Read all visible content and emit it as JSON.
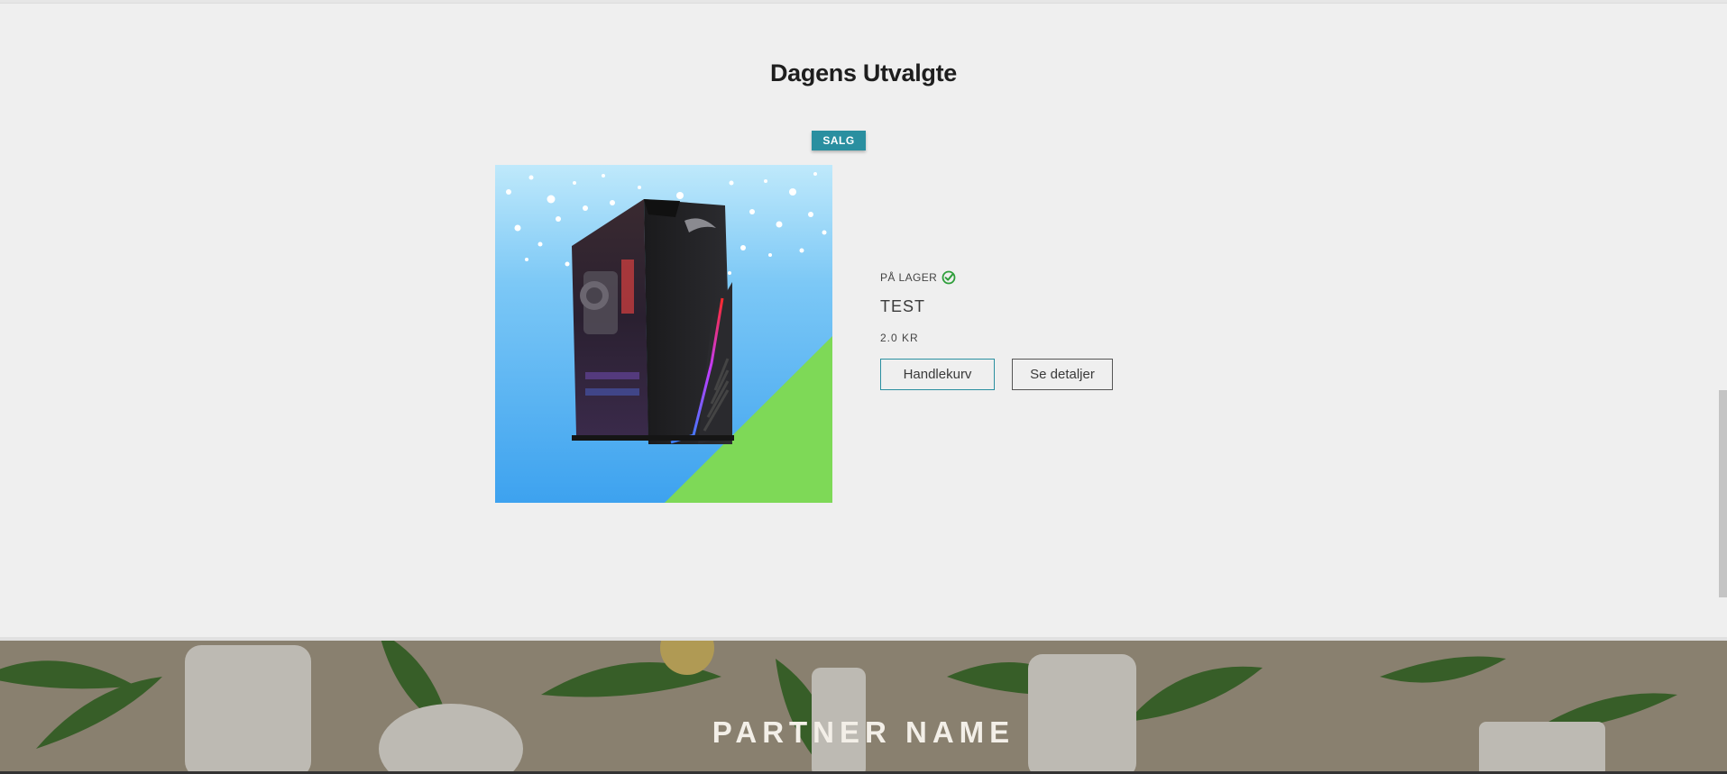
{
  "section": {
    "title": "Dagens Utvalgte"
  },
  "product": {
    "badge": "SALG",
    "stock_status": "PÅ LAGER",
    "name": "TEST",
    "price": "2.0 KR",
    "image_alt": "ROG gaming PC",
    "add_to_cart_label": "Handlekurv",
    "details_label": "Se detaljer"
  },
  "partner": {
    "title": "PARTNER NAME"
  },
  "colors": {
    "accent": "#2a8fa0",
    "in_stock": "#2e9e3a",
    "background": "#efefef"
  },
  "icons": {
    "stock": "check-circle-icon"
  }
}
